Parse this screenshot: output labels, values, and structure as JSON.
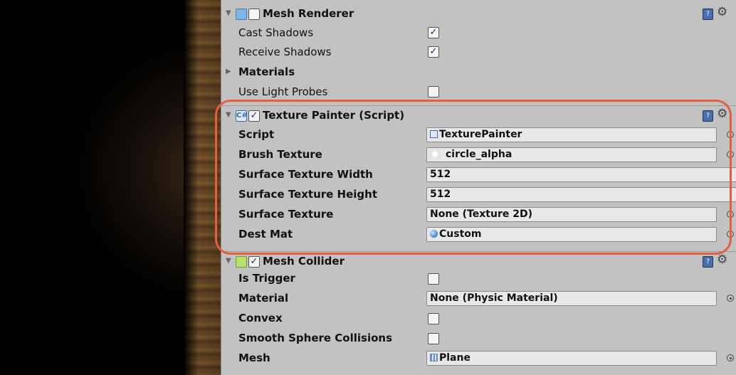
{
  "mesh_renderer": {
    "title": "Mesh Renderer",
    "enabled": false,
    "rows": [
      {
        "label": "Cast Shadows",
        "checked": true
      },
      {
        "label": "Receive Shadows",
        "checked": true
      }
    ],
    "materials_label": "Materials",
    "light_probes": {
      "label": "Use Light Probes",
      "checked": false
    }
  },
  "texture_painter": {
    "title": "Texture Painter (Script)",
    "enabled": true,
    "fields": [
      {
        "label": "Script",
        "value": "TexturePainter",
        "icon": "script-icon",
        "picker": true
      },
      {
        "label": "Brush Texture",
        "value": "circle_alpha",
        "icon": "texture-icon",
        "picker": true
      },
      {
        "label": "Surface Texture Width",
        "value": "512",
        "picker": false
      },
      {
        "label": "Surface Texture Height",
        "value": "512",
        "picker": false
      },
      {
        "label": "Surface Texture",
        "value": "None (Texture 2D)",
        "picker": true
      },
      {
        "label": "Dest Mat",
        "value": "Custom",
        "icon": "material-sphere-icon",
        "picker": true
      }
    ]
  },
  "mesh_collider": {
    "title": "Mesh Collider",
    "enabled": true,
    "is_trigger": {
      "label": "Is Trigger",
      "checked": false
    },
    "material": {
      "label": "Material",
      "value": "None (Physic Material)"
    },
    "convex": {
      "label": "Convex",
      "checked": false
    },
    "smooth": {
      "label": "Smooth Sphere Collisions",
      "checked": false
    },
    "mesh": {
      "label": "Mesh",
      "value": "Plane",
      "icon": "mesh-grid-icon"
    }
  },
  "colors": {
    "inspector_bg": "#c2c2c2",
    "highlight": "#e0603f",
    "checkmark": "#1a2a7a"
  },
  "icons": {
    "help": "?",
    "gear": "⚙",
    "foldout_open": "▼",
    "foldout_closed": "▶",
    "check": "✓"
  }
}
